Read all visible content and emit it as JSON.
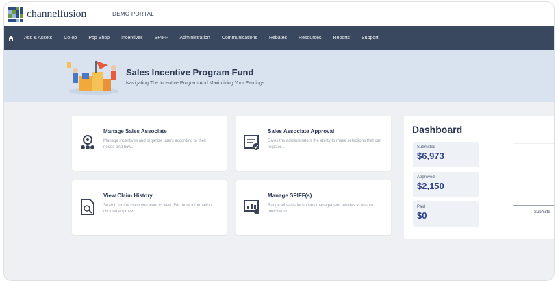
{
  "brand": {
    "name": "channelfusion",
    "portal": "DEMO PORTAL"
  },
  "nav": {
    "items": [
      "Ads & Assets",
      "Co-op",
      "Pop Shop",
      "Incentives",
      "SPIFF",
      "Administration",
      "Communications",
      "Rebates",
      "Resources",
      "Reports",
      "Support"
    ]
  },
  "hero": {
    "title": "Sales Incentive Program Fund",
    "subtitle": "Navigating The Incentive Program And Maximizing Your Earnings"
  },
  "cards": [
    {
      "title": "Manage Sales Associate",
      "desc": "Manage incentives and organize users according to their needs and how...",
      "icon": "gear-people-icon"
    },
    {
      "title": "Sales Associate Approval",
      "desc": "Gives the administrators the ability to make selections that can register...",
      "icon": "approval-form-icon"
    },
    {
      "title": "View Claim History",
      "desc": "Search for the claim you want to view. For more information click on approve...",
      "icon": "claim-document-icon"
    },
    {
      "title": "Manage SPIFF(s)",
      "desc": "Range all sales incentives management rebates to ensure merchants...",
      "icon": "spiff-chart-icon"
    }
  ],
  "dashboard": {
    "title": "Dashboard",
    "stats": [
      {
        "label": "Submitted",
        "value": "$6,973"
      },
      {
        "label": "Approved",
        "value": "$2,150"
      },
      {
        "label": "Paid",
        "value": "$0"
      }
    ],
    "chart_axis_label": "Submitte"
  },
  "colors": {
    "nav": "#39475f",
    "hero": "#d9e3ef",
    "accent": "#2e3f86"
  }
}
